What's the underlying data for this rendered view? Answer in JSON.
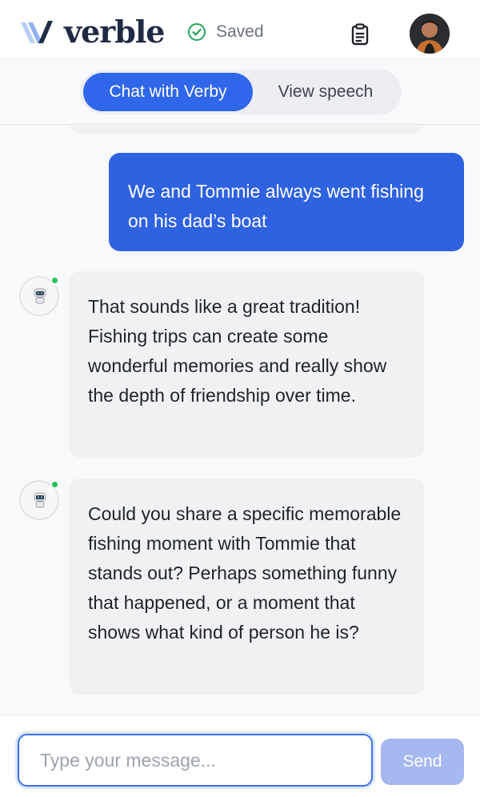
{
  "header": {
    "brand": "verble",
    "save_status": "Saved",
    "colors": {
      "brand_dark": "#1f2a44",
      "brand_light": "#8fb0f0",
      "success": "#22a35a"
    }
  },
  "tabs": [
    {
      "label": "Chat with Verby",
      "active": true
    },
    {
      "label": "View speech",
      "active": false
    }
  ],
  "messages": [
    {
      "sender": "user",
      "text": "We and Tommie always went fishing on his dad’s boat"
    },
    {
      "sender": "bot",
      "text": "That sounds like a great tradition! Fishing trips can create some wonderful memories and really show the depth of friendship over time."
    },
    {
      "sender": "bot",
      "text": "Could you share a specific memorable fishing moment with Tommie that stands out? Perhaps something funny that happened, or a moment that shows what kind of person he is?"
    }
  ],
  "composer": {
    "placeholder": "Type your message...",
    "value": "",
    "send_label": "Send"
  },
  "colors": {
    "accent": "#2f66ea",
    "user_bubble": "#2f62e0",
    "bot_bubble": "#f0f1f3",
    "send_disabled": "#a5b8f0",
    "online": "#22c55e"
  }
}
